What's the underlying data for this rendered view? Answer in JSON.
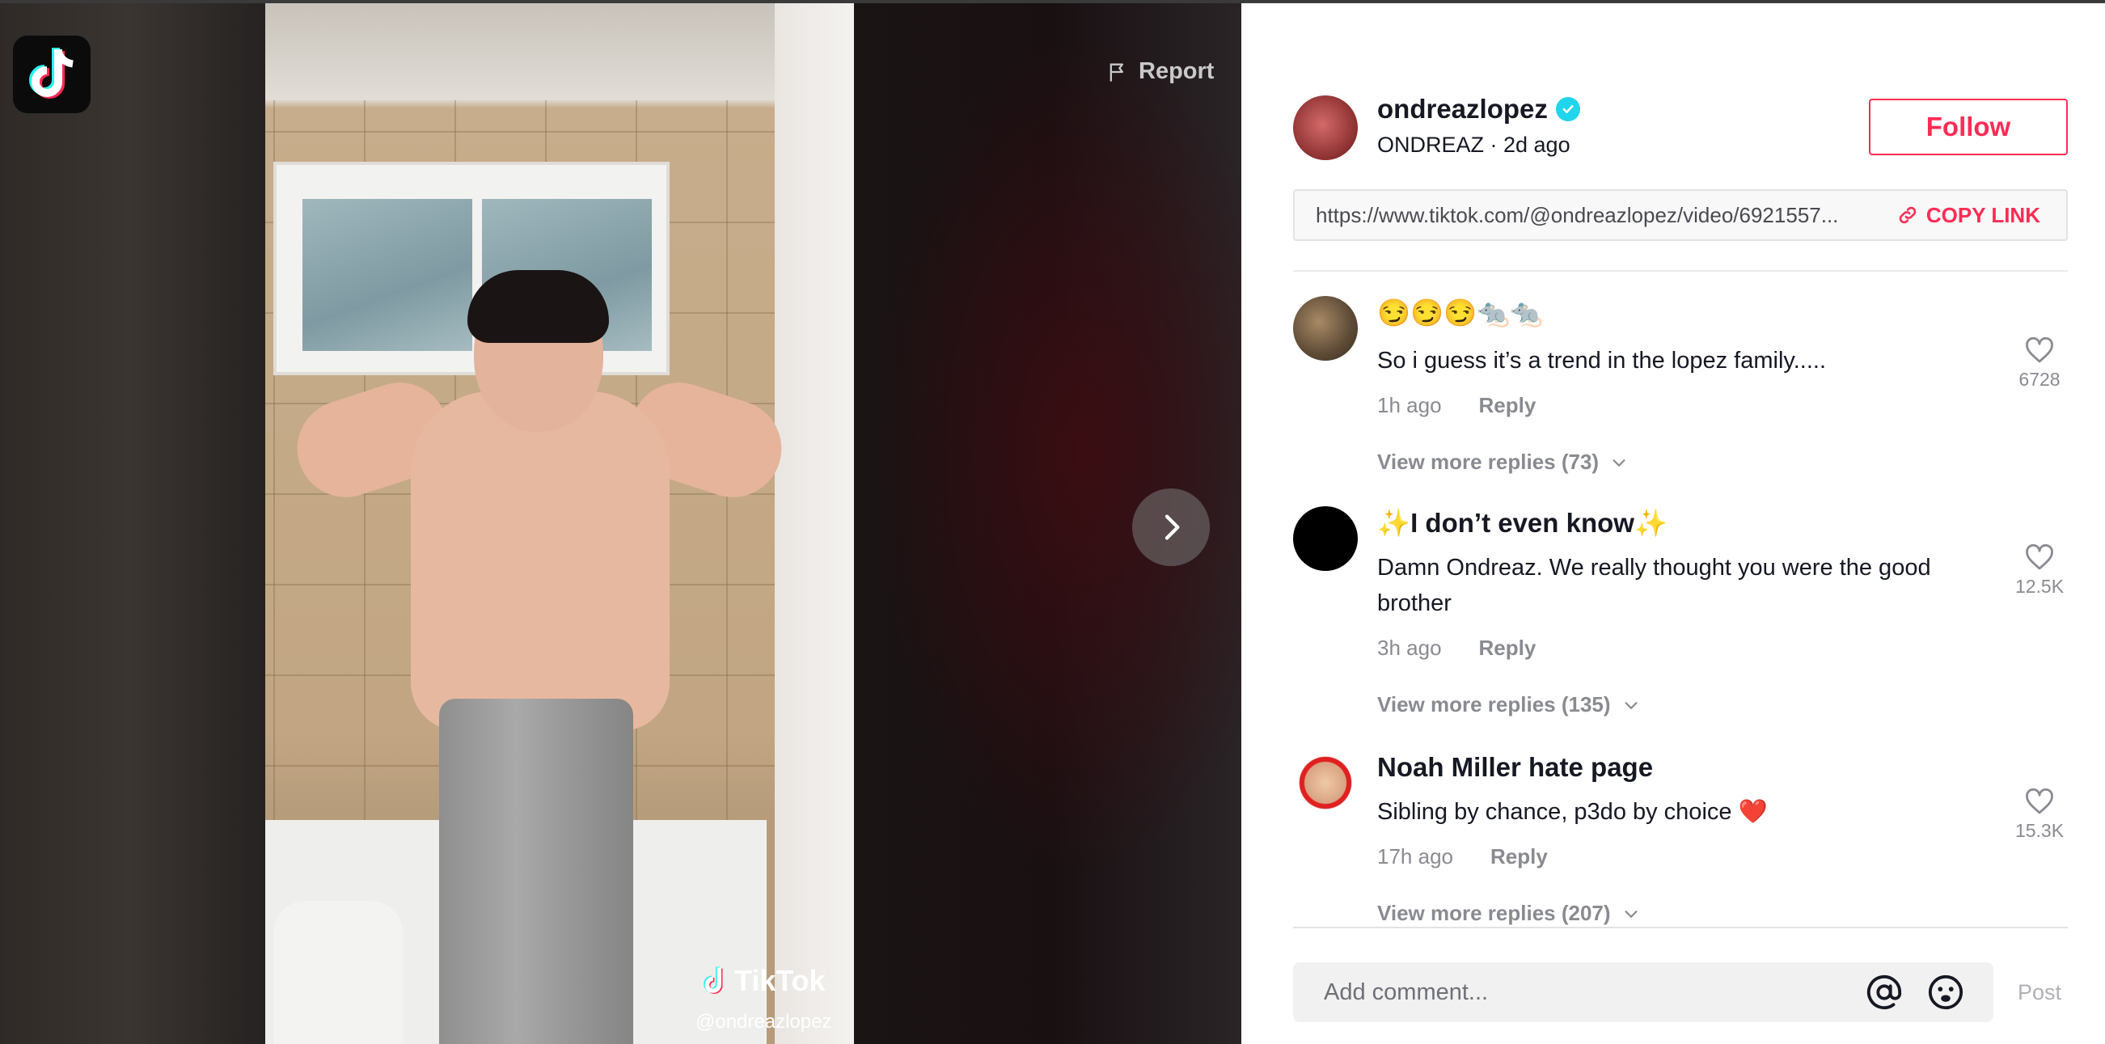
{
  "video": {
    "report_label": "Report",
    "watermark_label": "TikTok",
    "watermark_handle": "@ondreazlopez"
  },
  "author": {
    "username": "ondreazlopez",
    "nickname_line": "ONDREAZ · 2d ago",
    "follow_label": "Follow"
  },
  "share": {
    "url": "https://www.tiktok.com/@ondreazlopez/video/6921557...",
    "copy_label": "COPY LINK"
  },
  "comments": [
    {
      "username": "😏😏😏🐀🐀",
      "text": "So i guess it’s a trend in the lopez family.....",
      "time": "1h ago",
      "reply_label": "Reply",
      "likes": "6728",
      "view_more": "View more replies (73)"
    },
    {
      "username": "✨I don’t even know✨",
      "text": "Damn Ondreaz. We really thought you were the good brother",
      "time": "3h ago",
      "reply_label": "Reply",
      "likes": "12.5K",
      "view_more": "View more replies (135)"
    },
    {
      "username": "Noah Miller hate page",
      "text": "Sibling by chance, p3do by choice ❤️",
      "time": "17h ago",
      "reply_label": "Reply",
      "likes": "15.3K",
      "view_more": "View more replies (207)"
    }
  ],
  "composer": {
    "placeholder": "Add comment...",
    "post_label": "Post"
  },
  "colors": {
    "accent": "#fe2c55",
    "verified": "#20d5ec",
    "muted": "#8a8b91"
  }
}
